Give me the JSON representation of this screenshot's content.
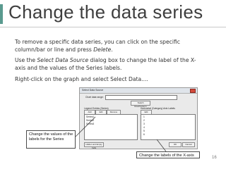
{
  "slide": {
    "title": "Change the data series",
    "page_number": "16",
    "accent_color": "#5a9a8f"
  },
  "body": {
    "p1_line1": "To remove a specific data series, you can click on the specific",
    "p1_line2_prefix": "column/bar or line and press ",
    "p1_line2_emph": "Delete",
    "p1_line2_suffix": ".",
    "p2_line1_prefix": "Use the ",
    "p2_line1_emph": "Select Data Source",
    "p2_line1_suffix": " dialog box to change the label of the X-",
    "p2_line2": "axis and the values of the Series labels.",
    "p3": "Right-click on the graph and select Select Data...."
  },
  "dialog": {
    "title": "Select Data Source",
    "chart_data_range_label": "Chart data range:",
    "switch_label": "Switch Row/Column",
    "legend_entries_label": "Legend Entries (Series)",
    "add_label": "Add",
    "edit_label": "Edit",
    "remove_label": "Remove",
    "axis_labels_label": "Horizontal (Category) Axis Labels",
    "axis_edit_label": "Edit",
    "series": [
      "Series1",
      "Series2",
      "Series3"
    ],
    "axis_values": [
      "1",
      "2",
      "3",
      "4",
      "5",
      "6"
    ],
    "hidden_cells_label": "Hidden and Empty Cells",
    "ok_label": "OK",
    "cancel_label": "Cancel"
  },
  "callouts": {
    "left_line1": "Change the values of the",
    "left_line2": "labels for the Series",
    "right": "Change the labels of the X-axis"
  }
}
